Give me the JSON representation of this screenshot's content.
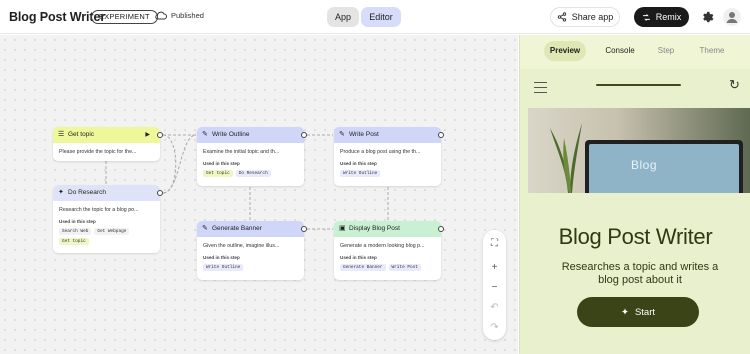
{
  "header": {
    "title": "Blog Post Writer",
    "badge": "EXPERIMENT",
    "status": "Published",
    "mode_app": "App",
    "mode_editor": "Editor",
    "share_label": "Share app",
    "remix_label": "Remix"
  },
  "nodes": {
    "get_topic": {
      "title": "Get topic",
      "desc": "Please provide the topic for the..."
    },
    "do_research": {
      "title": "Do Research",
      "desc": "Research the topic for a blog po...",
      "used": "Used in this step",
      "chips": [
        "Search Web",
        "Get Webpage",
        "Get topic"
      ]
    },
    "write_outline": {
      "title": "Write Outline",
      "desc": "Examine the initial topic and th...",
      "used": "Used in this step",
      "chips": [
        "Get topic",
        "Do Research"
      ]
    },
    "write_post": {
      "title": "Write Post",
      "desc": "Produce a blog post using the th...",
      "used": "Used in this step",
      "chips": [
        "Write Outline"
      ]
    },
    "generate_banner": {
      "title": "Generate Banner",
      "desc": "Given the outline, imagine illus...",
      "used": "Used in this step",
      "chips": [
        "Write Outline"
      ]
    },
    "display_blog_post": {
      "title": "Display Blog Post",
      "desc": "Generate a modern looking blog p...",
      "used": "Used in this step",
      "chips": [
        "Generate Banner",
        "Write Post"
      ]
    }
  },
  "right_panel": {
    "tabs": [
      "Preview",
      "Console",
      "Step",
      "Theme"
    ],
    "hero_word": "Blog",
    "app_title": "Blog Post Writer",
    "app_subtitle": "Researches a topic and writes a blog post about it",
    "start_label": "Start"
  },
  "colors": {
    "accent_input": "#eef79a",
    "accent_generate": "#cfd6f8",
    "accent_output": "#c9f0d2",
    "accent_tool": "#dfe3f7",
    "preview_bg": "#e9f0cd",
    "start_button": "#3b4416"
  }
}
